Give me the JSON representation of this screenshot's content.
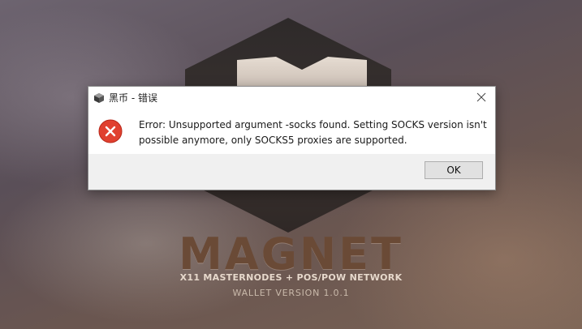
{
  "splash": {
    "brand_name": "MAGNET",
    "tagline": "X11 MASTERNODES + POS/POW NETWORK",
    "version": "WALLET VERSION 1.0.1"
  },
  "dialog": {
    "title": "黑币 - 错误",
    "app_icon": "cube-app-icon",
    "close_icon": "close-icon",
    "message_icon": "error-icon",
    "message_line1": "Error: Unsupported argument -socks found. Setting SOCKS version isn't",
    "message_line2": "possible anymore, only SOCKS5 proxies are supported.",
    "ok_label": "OK"
  },
  "colors": {
    "error_red": "#e0402f",
    "brand_brown": "#6a4a36"
  }
}
